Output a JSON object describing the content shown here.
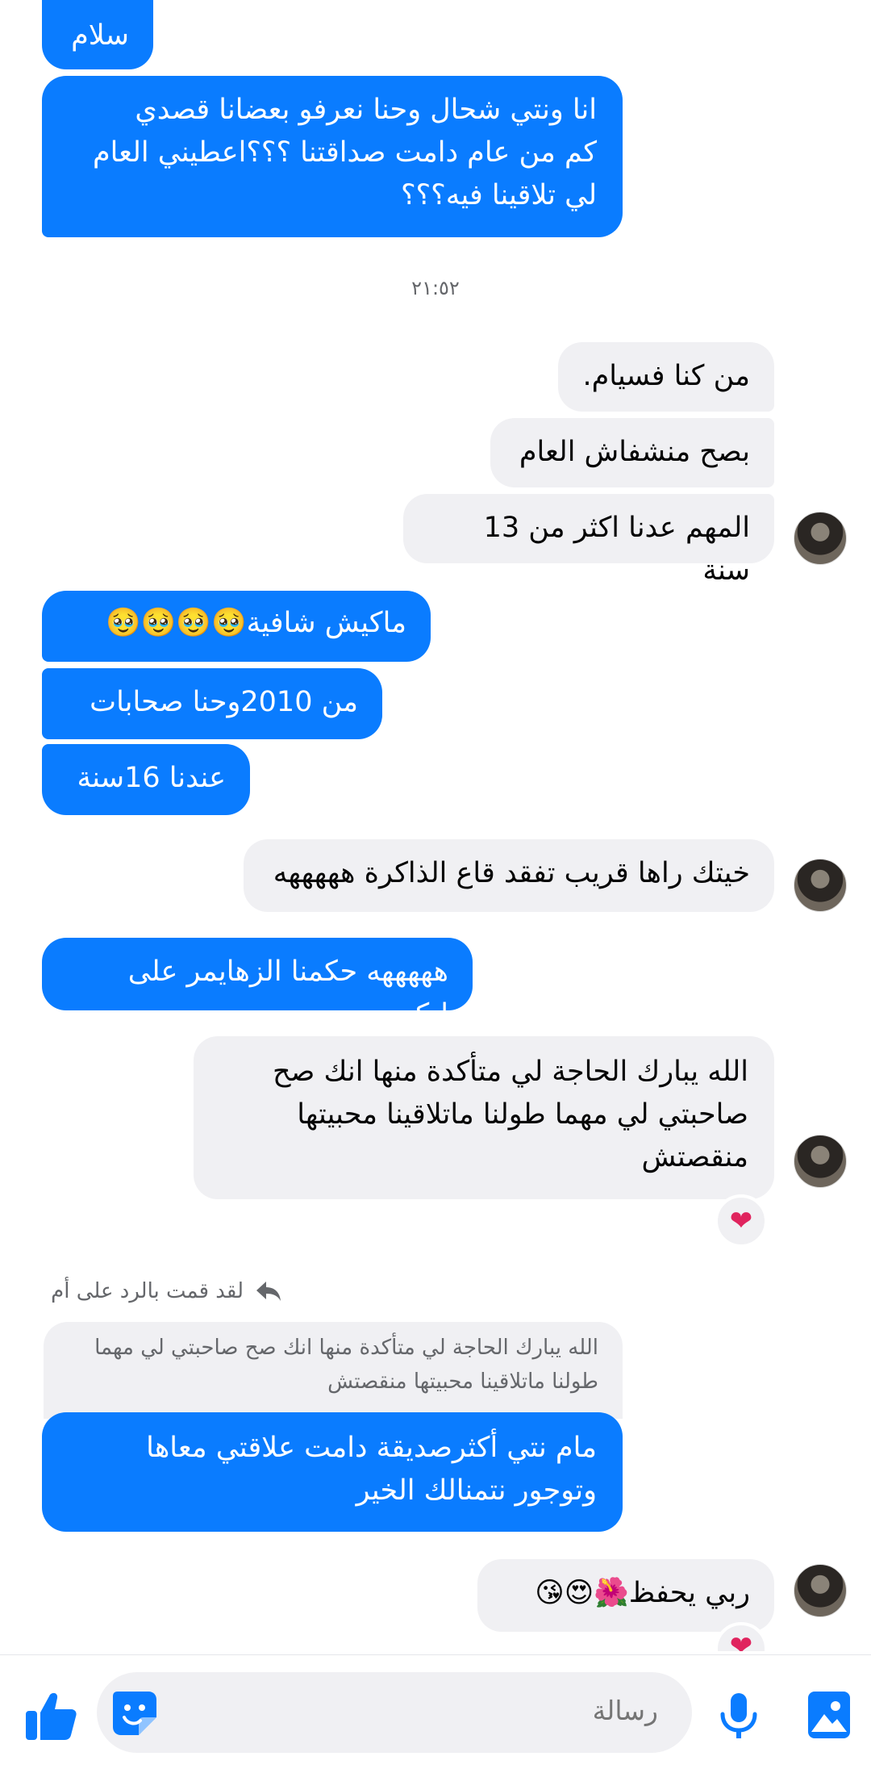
{
  "messages": [
    {
      "side": "out",
      "text": "سلام"
    },
    {
      "side": "out",
      "text": "انا ونتي شحال وحنا نعرفو بعضانا قصدي\nكم من عام دامت صداقتنا ؟؟؟اعطيني العام\nلي تلاقينا فيه؟؟؟"
    },
    {
      "side": "in",
      "text": "من كنا فسيام."
    },
    {
      "side": "in",
      "text": "بصح منشفاش العام"
    },
    {
      "side": "in",
      "text": "المهم عدنا اكثر من 13 سنة"
    },
    {
      "side": "out",
      "text": "ماكيش شافية🥹🥹🥹🥹"
    },
    {
      "side": "out",
      "text": "من 2010وحنا صحابات"
    },
    {
      "side": "out",
      "text": "عندنا 16سنة"
    },
    {
      "side": "in",
      "text": "خيتك راها قريب تفقد قاع الذاكرة هههههه"
    },
    {
      "side": "out",
      "text": "هههههه حكمنا الزهايمر على لبكري"
    },
    {
      "side": "in",
      "text": "الله يبارك الحاجة لي متأكدة منها انك صح\nصاحبتي لي مهما طولنا ماتلاقينا محبيتها\nمنقصتش"
    },
    {
      "side": "out",
      "text": "مام نتي أكثرصديقة دامت علاقتي معاها\nوتوجور نتمنالك الخير"
    },
    {
      "side": "in",
      "text": "ربي يحفظ🌺😍😘"
    }
  ],
  "time_separator": "٢١:٥٢",
  "reactions": [
    "❤",
    "❤"
  ],
  "reply": {
    "note": "لقد قمت بالرد على أم",
    "quoted_text": "الله يبارك الحاجة لي متأكدة منها انك صح صاحبتي لي مهما\nطولنا ماتلاقينا محبيتها منقصتش"
  },
  "composer": {
    "placeholder": "رسالة",
    "icons": [
      "like-icon",
      "sticker-icon",
      "microphone-icon",
      "gallery-icon"
    ]
  },
  "colors": {
    "accent": "#0a7cff",
    "incoming": "#f0f0f3",
    "reaction": "#e0245e"
  }
}
